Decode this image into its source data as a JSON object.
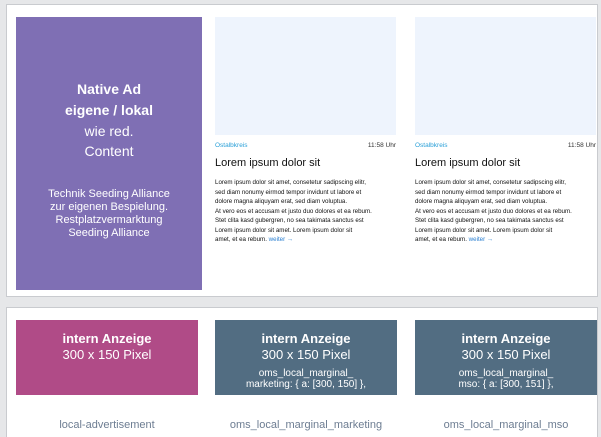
{
  "native_ad": {
    "title_line1": "Native Ad",
    "title_line2": "eigene / lokal",
    "subtitle_line1": "wie red.",
    "subtitle_line2": "Content",
    "desc_line1": "Technik Seeding Alliance",
    "desc_line2": "zur eigenen Bespielung.",
    "desc_line3": "Restplatzvermarktung",
    "desc_line4": "Seeding Alliance",
    "color": "#7f6fb4"
  },
  "articles": [
    {
      "region": "Ostalbkreis",
      "time": "11:58 Uhr",
      "title": "Lorem ipsum dolor sit",
      "body": [
        "Lorem ipsum dolor sit amet, consetetur sadipscing elitr,",
        "sed diam nonumy eirmod tempor invidunt ut labore et",
        "dolore magna aliquyam erat, sed diam voluptua.",
        "At vero eos et accusam et justo duo dolores et ea rebum.",
        "Stet clita kasd gubergren, no sea takimata sanctus est",
        "Lorem ipsum dolor sit amet. Lorem ipsum dolor sit",
        "amet,  et ea rebum."
      ],
      "more": "weiter →"
    },
    {
      "region": "Ostalbkreis",
      "time": "11:58 Uhr",
      "title": "Lorem ipsum dolor sit",
      "body": [
        "Lorem ipsum dolor sit amet, consetetur sadipscing elitr,",
        "sed diam nonumy eirmod tempor invidunt ut labore et",
        "dolore magna aliquyam erat, sed diam voluptua.",
        "At vero eos et accusam et justo duo dolores et ea rebum.",
        "Stet clita kasd gubergren, no sea takimata sanctus est",
        "Lorem ipsum dolor sit amet. Lorem ipsum dolor sit",
        "amet,  et ea rebum."
      ],
      "more": "weiter →"
    }
  ],
  "ads": [
    {
      "heading": "intern Anzeige",
      "size": "300 x 150 Pixel",
      "code_line1": "",
      "code_line2": "",
      "label": "local-advertisement",
      "color": "#b04b87"
    },
    {
      "heading": "intern Anzeige",
      "size": "300 x 150 Pixel",
      "code_line1": "oms_local_marginal_",
      "code_line2": "marketing: { a: [300, 150] },",
      "label": "oms_local_marginal_marketing",
      "color": "#526d82"
    },
    {
      "heading": "intern Anzeige",
      "size": "300 x 150 Pixel",
      "code_line1": "oms_local_marginal_",
      "code_line2": "mso: { a: [300, 151] },",
      "label": "oms_local_marginal_mso",
      "color": "#526d82"
    }
  ]
}
